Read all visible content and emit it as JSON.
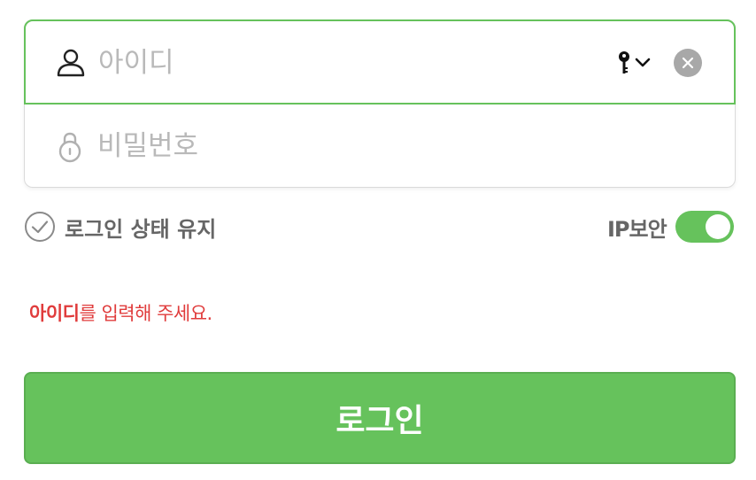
{
  "login_form": {
    "id_field": {
      "placeholder": "아이디",
      "value": "",
      "icon": "user-icon"
    },
    "key_select": {
      "icon": "key-icon",
      "dropdown_icon": "chevron-down-icon"
    },
    "clear_button": {
      "icon": "close-icon"
    },
    "password_field": {
      "placeholder": "비밀번호",
      "value": "",
      "icon": "lock-icon"
    }
  },
  "options": {
    "keep_login_label": "로그인 상태 유지",
    "keep_login_checked": false,
    "ip_security_label": "IP보안",
    "ip_security_on": true
  },
  "error": {
    "emphasis": "아이디",
    "message": "를 입력해 주세요."
  },
  "login_button_label": "로그인",
  "colors": {
    "accent_green": "#66c25c",
    "error_red": "#e03c3c",
    "placeholder_gray": "#b9b9b9"
  }
}
